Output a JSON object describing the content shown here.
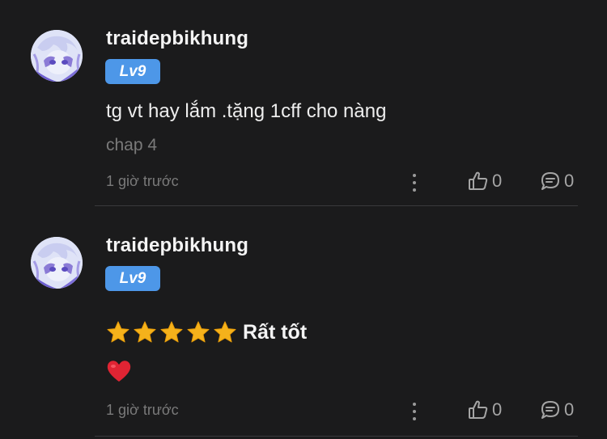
{
  "comments": [
    {
      "username": "traidepbikhung",
      "level": "Lv9",
      "text": "tg vt hay lắm .tặng 1cff cho nàng",
      "chapter": "chap 4",
      "time": "1 giờ trước",
      "likes": "0",
      "replies": "0"
    },
    {
      "username": "traidepbikhung",
      "level": "Lv9",
      "rating_stars": 5,
      "rating_label": "Rất tốt",
      "emoji": "heart-emoji",
      "time": "1 giờ trước",
      "likes": "0",
      "replies": "0"
    }
  ],
  "colors": {
    "background": "#1b1b1c",
    "level_badge": "#4d97e8",
    "star": "#f5b21b",
    "heart": "#e02433",
    "muted_text": "#7a7a7a"
  },
  "icons": [
    "avatar-image",
    "more-dots-icon",
    "thumbs-up-icon",
    "comment-bubble-icon",
    "star-icon",
    "heart-emoji"
  ]
}
